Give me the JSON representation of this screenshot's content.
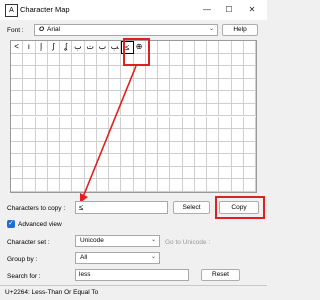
{
  "window": {
    "title": "Character Map",
    "minimize": "—",
    "maximize": "☐",
    "close": "✕"
  },
  "font": {
    "label": "Font :",
    "icon": "O",
    "value": "Arial",
    "help_label": "Help"
  },
  "grid": {
    "characters": [
      "<",
      "ı",
      "إ",
      "ʃ",
      "ʆ",
      "ب",
      "ت",
      "ب",
      "ﺐ",
      "≤",
      "⊕"
    ],
    "selected_index": 9,
    "columns": 20,
    "rows": 12
  },
  "copy": {
    "label": "Characters to copy :",
    "value": "≤",
    "select_label": "Select",
    "copy_label": "Copy"
  },
  "advanced": {
    "label": "Advanced view",
    "checked": true,
    "check_glyph": "✓"
  },
  "charset": {
    "label": "Character set :",
    "value": "Unicode",
    "goto_label": "Go to Unicode :"
  },
  "groupby": {
    "label": "Group by :",
    "value": "All"
  },
  "search": {
    "label": "Search for :",
    "value": "less",
    "reset_label": "Reset"
  },
  "status": {
    "text": "U+2264: Less-Than Or Equal To"
  },
  "annotation_color": "#e02020"
}
